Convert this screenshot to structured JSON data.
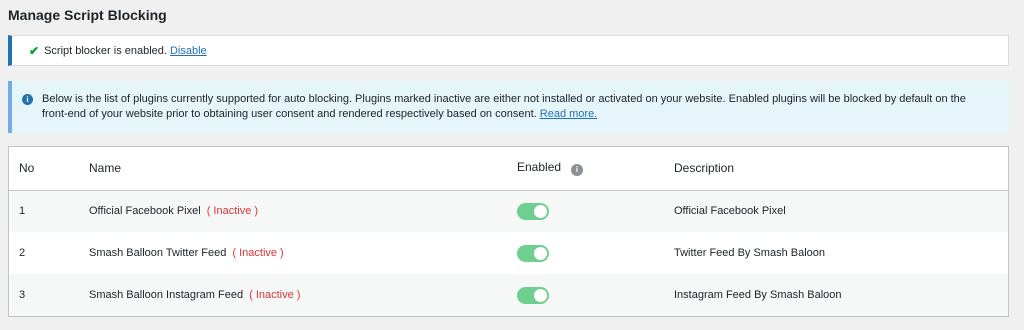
{
  "page": {
    "title": "Manage Script Blocking"
  },
  "success_notice": {
    "text": "Script blocker is enabled.",
    "link": "Disable"
  },
  "info_notice": {
    "line1": "Below is the list of plugins currently supported for auto blocking. Plugins marked inactive are either not installed or activated on your website. Enabled plugins will be blocked by default on the",
    "line2": "front-end of your website prior to obtaining user consent and rendered respectively based on consent.",
    "link": "Read more."
  },
  "table": {
    "headers": {
      "no": "No",
      "name": "Name",
      "enabled": "Enabled",
      "description": "Description"
    },
    "rows": [
      {
        "no": "1",
        "name": "Official Facebook Pixel",
        "status": "( Inactive )",
        "enabled": true,
        "description": "Official Facebook Pixel"
      },
      {
        "no": "2",
        "name": "Smash Balloon Twitter Feed",
        "status": "( Inactive )",
        "enabled": true,
        "description": "Twitter Feed By Smash Baloon"
      },
      {
        "no": "3",
        "name": "Smash Balloon Instagram Feed",
        "status": "( Inactive )",
        "enabled": true,
        "description": "Instagram Feed By Smash Baloon"
      }
    ]
  },
  "colors": {
    "accent": "#2271b1",
    "success": "#00a32a",
    "inactive": "#d63638",
    "toggle_on": "#6fcf8f"
  },
  "icons": {
    "success": "check-icon",
    "info": "info-icon",
    "help": "help-icon"
  }
}
